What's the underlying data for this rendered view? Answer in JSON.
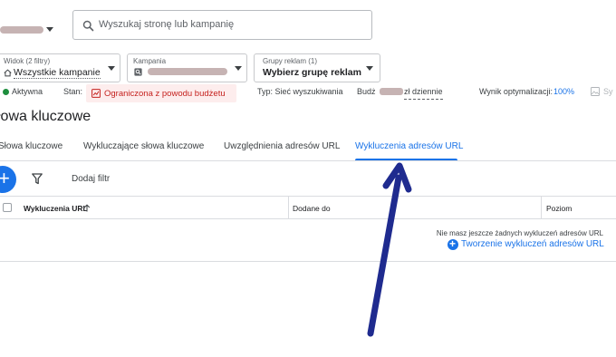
{
  "search": {
    "placeholder": "Wyszukaj stronę lub kampanię",
    "icon": "search-icon"
  },
  "filters": {
    "view": {
      "label": "Widok (2 filtry)",
      "value": "Wszystkie kampanie"
    },
    "campaign": {
      "label": "Kampania"
    },
    "adgroups": {
      "label": "Grupy reklam (1)",
      "value": "Wybierz grupę reklam"
    }
  },
  "status_row": {
    "status": "Aktywna",
    "state_label": "Stan:",
    "state_value": "Ograniczona z powodu budżetu",
    "type": "Typ: Sieć wyszukiwania",
    "budget_prefix": "Budż",
    "budget_suffix": "zł dziennie",
    "opt_label": "Wynik optymalizacji:",
    "opt_value": "100%",
    "trailing": "Sy"
  },
  "section_title": "łowa kluczowe",
  "tabs": [
    {
      "label": "Słowa kluczowe",
      "active": false
    },
    {
      "label": "Wykluczające słowa kluczowe",
      "active": false
    },
    {
      "label": "Uwzględnienia adresów URL",
      "active": false
    },
    {
      "label": "Wykluczenia adresów URL",
      "active": true
    }
  ],
  "toolbar": {
    "add_filter": "Dodaj filtr"
  },
  "table": {
    "columns": [
      "Wykluczenia URL",
      "Dodane do",
      "Poziom"
    ],
    "empty_message": "Nie masz jeszcze żadnych wykluczeń adresów URL",
    "create_link": "Tworzenie wykluczeń adresów URL"
  },
  "colors": {
    "accent": "#1a73e8",
    "warning": "#c5221f",
    "active": "#1e8e3e",
    "annotation_arrow": "#1f2b8f"
  }
}
